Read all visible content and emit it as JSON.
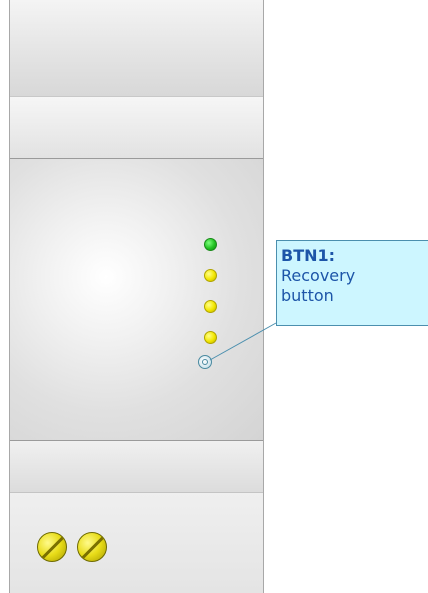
{
  "device": {
    "leds": [
      {
        "color": "green",
        "hex": "#22c222"
      },
      {
        "color": "yellow",
        "hex": "#f2e600"
      },
      {
        "color": "yellow",
        "hex": "#f2e600"
      },
      {
        "color": "yellow",
        "hex": "#f2e600"
      }
    ],
    "terminals": 2
  },
  "callout": {
    "title": "BTN1:",
    "body": "Recovery button",
    "background": "#cdf6ff",
    "border": "#4b8fae",
    "text_color": "#1d55a8"
  }
}
